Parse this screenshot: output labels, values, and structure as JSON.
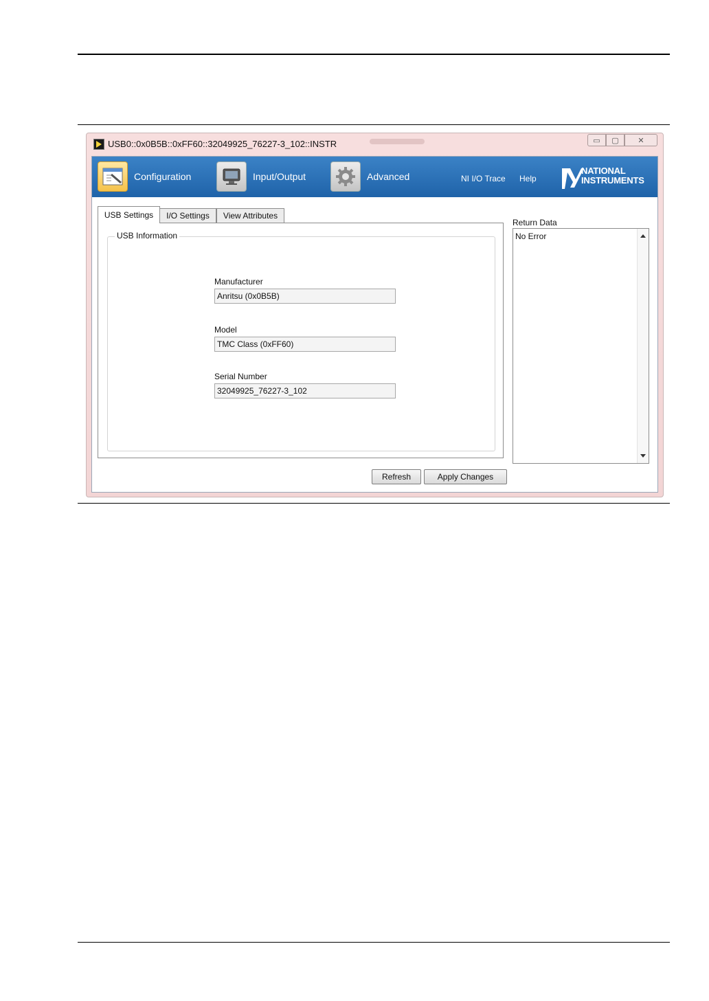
{
  "window": {
    "title": "USB0::0x0B5B::0xFF60::32049925_76227-3_102::INSTR",
    "controls": {
      "minimize": "▭",
      "maximize": "▢",
      "close": "✕"
    }
  },
  "header": {
    "nav": [
      {
        "label": "Configuration",
        "icon": "configuration-icon"
      },
      {
        "label": "Input/Output",
        "icon": "monitor-icon"
      },
      {
        "label": "Advanced",
        "icon": "gear-icon"
      }
    ],
    "links": {
      "trace": "NI I/O Trace",
      "help": "Help"
    },
    "logo": {
      "line1": "NATIONAL",
      "line2": "INSTRUMENTS"
    },
    "colors": {
      "band_top": "#3b82c6",
      "band_bottom": "#1f63a9"
    }
  },
  "tabs": [
    "USB Settings",
    "I/O Settings",
    "View Attributes"
  ],
  "usb_info": {
    "group_title": "USB Information",
    "manufacturer_label": "Manufacturer",
    "manufacturer_value": "Anritsu (0x0B5B)",
    "model_label": "Model",
    "model_value": "TMC Class (0xFF60)",
    "serial_label": "Serial Number",
    "serial_value": "32049925_76227-3_102"
  },
  "return_data": {
    "label": "Return Data",
    "value": "No Error"
  },
  "buttons": {
    "refresh": "Refresh",
    "apply": "Apply Changes"
  }
}
